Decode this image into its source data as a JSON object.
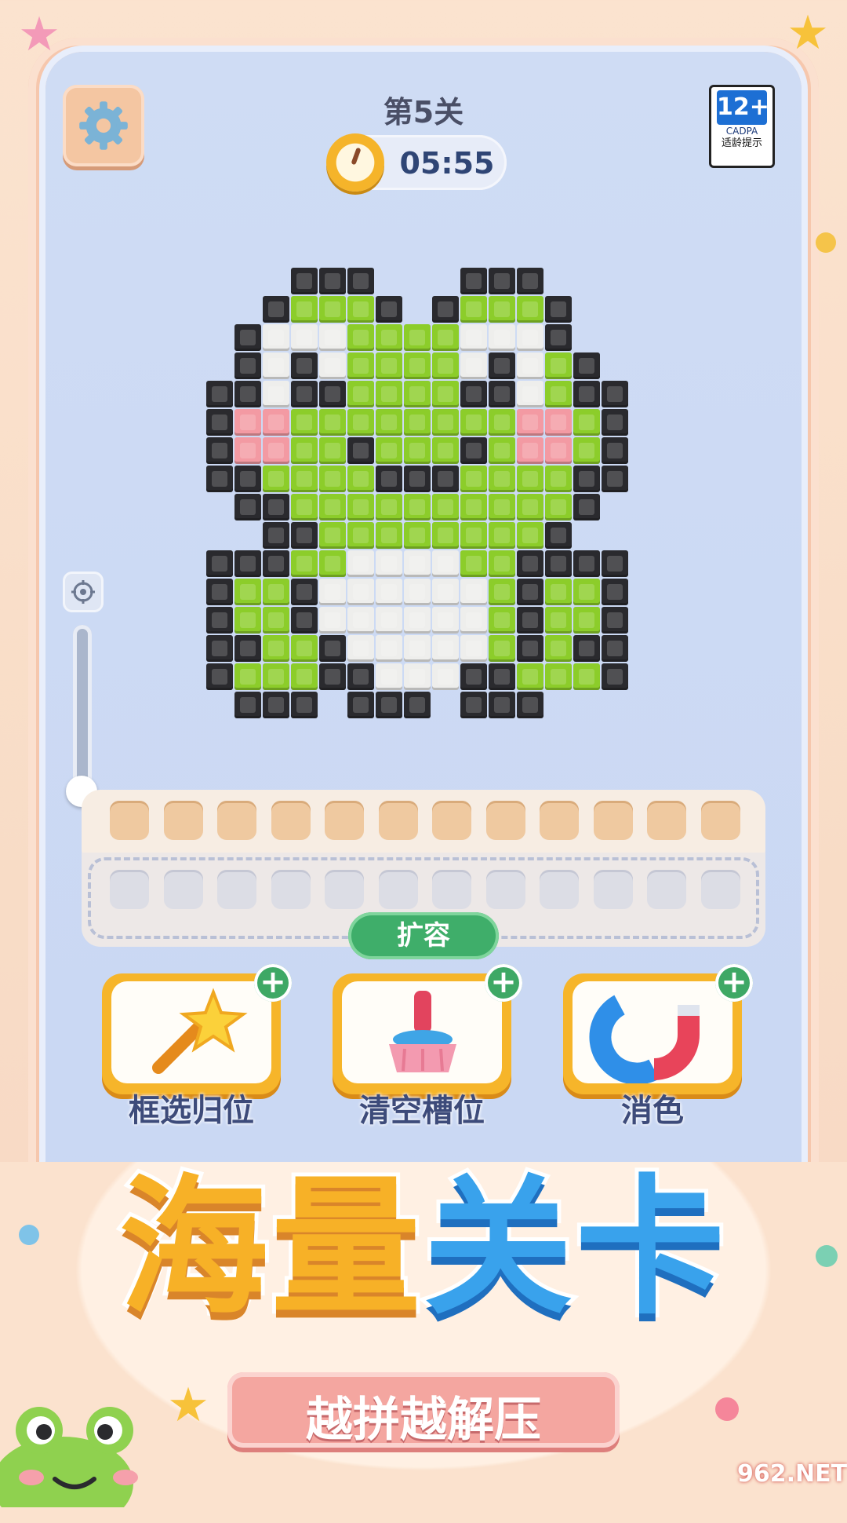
{
  "header": {
    "level": "第5关",
    "timer": "05:55"
  },
  "age_rating": {
    "number": "12+",
    "org": "CADPA",
    "tip": "适龄提示"
  },
  "tray": {
    "top_slots": 12,
    "bottom_slots": 12,
    "expand_label": "扩容"
  },
  "powerups": [
    {
      "label": "框选归位",
      "icon": "magic-wand-icon"
    },
    {
      "label": "清空槽位",
      "icon": "broom-icon"
    },
    {
      "label": "消色",
      "icon": "magnet-icon"
    }
  ],
  "banner": {
    "title_part1": "海量",
    "title_part2": "关卡",
    "subtitle": "越拼越解压"
  },
  "watermark": "962.NET",
  "colors": {
    "black": "#2a2a2e",
    "green": "#8ccd2a",
    "white": "#eeeeec",
    "pink": "#f39aa3"
  },
  "pixel_art": [
    "...KKK...KKK...",
    "..KGGGK.KGGGK..",
    ".KWWWGGGGWWWK..",
    ".KWKWGGGGWKWGK.",
    "KKWKKGGGGKKWGKK",
    "KPPGGGGGGGGPPGK",
    "KPPGGKGGGKGPPGK",
    "KKGGGGKKKGGGGKK",
    ".KKGGGGGGGGGGK.",
    "..KKGGGGGGGGK..",
    "KKKGGWWWWGGKKKK",
    "KGGKWWWWWWGKGGK",
    "KGGKWWWWWWGKGGK",
    "KKGGKWWWWWGKGKK",
    "KGGGKKWWWKKGGGK",
    ".KKK.KKK.KKK..."
  ]
}
